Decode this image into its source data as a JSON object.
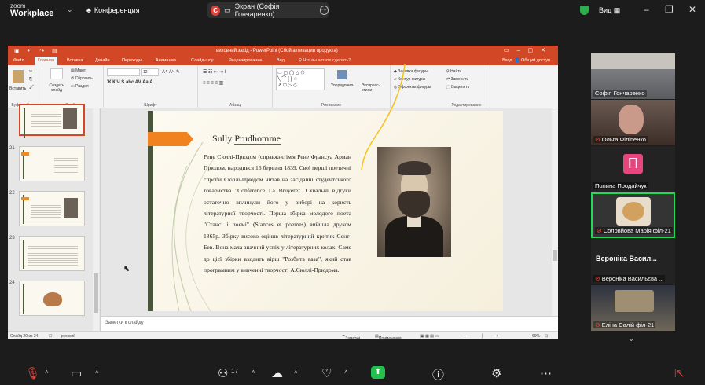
{
  "zoom": {
    "logo_top": "zoom",
    "logo_bottom": "Workplace",
    "meeting_name": "Конференция",
    "share_label": "Экран (Софія Гончаренко)",
    "share_initial": "С",
    "view_label": "Вид"
  },
  "ppt": {
    "window_title": "виховний захід - PowerPoint (Сбой активации продукта)",
    "tabs": [
      "Файл",
      "Главная",
      "Вставка",
      "Дизайн",
      "Переходы",
      "Анимация",
      "Слайд-шоу",
      "Рецензирование",
      "Вид"
    ],
    "active_tab": "Главная",
    "tell_me": "Что вы хотите сделать?",
    "sign_in": "Вход",
    "share": "Общий доступ",
    "ribbon": {
      "paste": "Вставить",
      "clipboard": "Буфер обмена",
      "new_slide": "Создать слайд",
      "layout": "Макет",
      "reset": "Сбросить",
      "section": "Раздел",
      "slides": "Слайды",
      "font_size": "12",
      "font": "Шрифт",
      "paragraph": "Абзац",
      "arrange": "Упорядочить",
      "quick_styles": "Экспресс-стили",
      "drawing": "Рисование",
      "shape_fill": "Заливка фигуры",
      "shape_outline": "Контур фигуры",
      "shape_effects": "Эффекты фигуры",
      "find": "Найти",
      "replace": "Заменить",
      "select": "Выделить",
      "editing": "Редактирование"
    },
    "thumbnails": [
      {
        "num": "",
        "selected": true,
        "kind": "portrait"
      },
      {
        "num": "21",
        "selected": false,
        "kind": "text"
      },
      {
        "num": "22",
        "selected": false,
        "kind": "portrait"
      },
      {
        "num": "23",
        "selected": false,
        "kind": "text"
      },
      {
        "num": "24",
        "selected": false,
        "kind": "heart"
      }
    ],
    "slide": {
      "title_first": "Sully",
      "title_second": "Prudhomme",
      "body": "Рене Сюллі-Прюдом (справжнє ім'я Рене Франсуа Арман Прюдом, народився 16 березня 1839. Свої перші поетичні спроби Сюллі-Прюдом читав на засіданні студентського товариства \"Conference La Bruyere\". Схвальні відгуки остаточно вплинули його у виборі на користь літературної творчості. Перша збірка молодого поета \"Стансі і поемі\" (Stances et poemes) вийшла друком 1865р. Збірку високо оцінив літературний критик Сент-Бев. Вона мала значний успіх у літературних колах. Саме до цієї збірки входить вірш \"Розбита ваза\", який став програмним у вивченні творчості А.Сюллі-Прюдома."
    },
    "notes_placeholder": "Заметки к слайду",
    "status": {
      "slide_count": "Слайд 20 из 24",
      "language": "русский",
      "notes": "Заметки",
      "comments": "Примечания",
      "zoom": "69%"
    }
  },
  "participants": [
    {
      "name": "Софія Гончаренко",
      "muted": false,
      "kind": "video"
    },
    {
      "name": "Ольга Філіпенко",
      "muted": true,
      "kind": "video"
    },
    {
      "name": "Полина Продайчук",
      "muted": false,
      "kind": "avatar",
      "initial": "П"
    },
    {
      "name": "Соловйова Марія філ-21",
      "muted": true,
      "kind": "video",
      "active": true
    },
    {
      "name": "Вероніка Васильєва ...",
      "muted": true,
      "kind": "name",
      "big_name": "Вероніка Васил..."
    },
    {
      "name": "Еліна Салій філ-21",
      "muted": true,
      "kind": "video"
    }
  ],
  "toolbar": {
    "participants_count": "17"
  },
  "colors": {
    "ppt_accent": "#d24726",
    "active_speaker": "#23d959",
    "avatar_pink": "#e6467d",
    "share_green": "#23c04f"
  }
}
